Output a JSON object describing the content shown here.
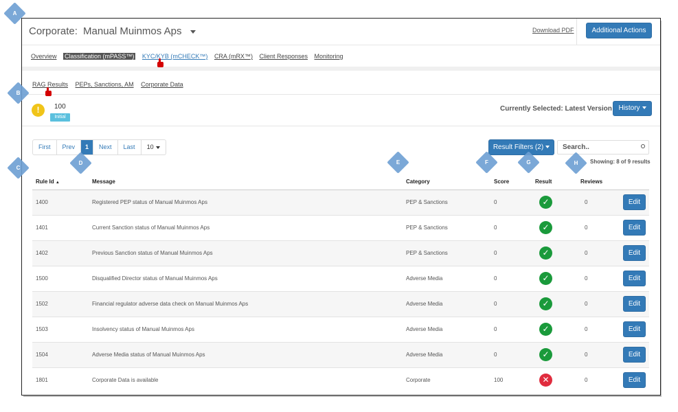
{
  "header": {
    "title_prefix": "Corporate:",
    "title_name": "Manual Muinmos Aps",
    "download": "Download PDF",
    "additional_actions": "Additional Actions"
  },
  "nav_tabs": [
    {
      "label": "Overview",
      "state": "normal"
    },
    {
      "label": "Classification (mPASS™)",
      "state": "active"
    },
    {
      "label": "KYC/KYB (mCHECK™)",
      "state": "link"
    },
    {
      "label": "CRA (mRX™)",
      "state": "normal"
    },
    {
      "label": "Client Responses",
      "state": "normal"
    },
    {
      "label": "Monitoring",
      "state": "normal"
    }
  ],
  "sub_tabs": [
    "RAG Results",
    "PEPs, Sanctions, AM",
    "Corporate Data"
  ],
  "summary": {
    "score": "100",
    "badge": "Initial",
    "currently_selected": "Currently Selected: Latest Version",
    "history": "History"
  },
  "pager": {
    "first": "First",
    "prev": "Prev",
    "current": "1",
    "next": "Next",
    "last": "Last",
    "page_size": "10"
  },
  "filters": {
    "result_filters": "Result Filters (2)",
    "search_placeholder": "Search..",
    "showing": "Showing: 8 of 9 results"
  },
  "table": {
    "headers": [
      "Rule Id",
      "Message",
      "Category",
      "Score",
      "Result",
      "Reviews",
      ""
    ],
    "rows": [
      {
        "id": "1400",
        "message": "Registered PEP status of Manual Muinmos Aps",
        "category": "PEP & Sanctions",
        "score": "0",
        "result": "pass",
        "reviews": "0",
        "action": "Edit"
      },
      {
        "id": "1401",
        "message": "Current Sanction status of Manual Muinmos Aps",
        "category": "PEP & Sanctions",
        "score": "0",
        "result": "pass",
        "reviews": "0",
        "action": "Edit"
      },
      {
        "id": "1402",
        "message": "Previous Sanction status of Manual Muinmos Aps",
        "category": "PEP & Sanctions",
        "score": "0",
        "result": "pass",
        "reviews": "0",
        "action": "Edit"
      },
      {
        "id": "1500",
        "message": "Disqualified Director status of Manual Muinmos Aps",
        "category": "Adverse Media",
        "score": "0",
        "result": "pass",
        "reviews": "0",
        "action": "Edit"
      },
      {
        "id": "1502",
        "message": "Financial regulator adverse data check on Manual Muinmos Aps",
        "category": "Adverse Media",
        "score": "0",
        "result": "pass",
        "reviews": "0",
        "action": "Edit"
      },
      {
        "id": "1503",
        "message": "Insolvency status of Manual Muinmos Aps",
        "category": "Adverse Media",
        "score": "0",
        "result": "pass",
        "reviews": "0",
        "action": "Edit"
      },
      {
        "id": "1504",
        "message": "Adverse Media status of Manual Muinmos Aps",
        "category": "Adverse Media",
        "score": "0",
        "result": "pass",
        "reviews": "0",
        "action": "Edit"
      },
      {
        "id": "1801",
        "message": "Corporate Data is available",
        "category": "Corporate",
        "score": "100",
        "result": "fail",
        "reviews": "0",
        "action": "Edit"
      }
    ]
  },
  "markers": [
    "A",
    "B",
    "C",
    "D",
    "E",
    "F",
    "G",
    "H"
  ],
  "colors": {
    "primary": "#337ab7",
    "pass": "#1a9a3b",
    "fail": "#e02c3e",
    "warning": "#f0c419",
    "badge": "#5bc0de",
    "marker": "#6d9fd3"
  }
}
